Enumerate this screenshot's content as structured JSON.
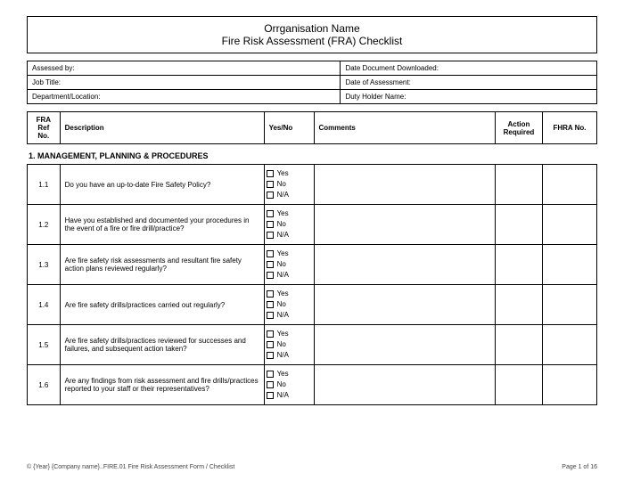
{
  "title": {
    "line1": "Orrganisation Name",
    "line2": "Fire Risk Assessment (FRA) Checklist"
  },
  "meta": {
    "assessed_by": "Assessed by:",
    "date_downloaded": "Date Document Downloaded:",
    "job_title": "Job Title:",
    "date_assessment": "Date of Assessment:",
    "dept_loc": "Department/Location:",
    "duty_holder": "Duty Holder Name:"
  },
  "headers": {
    "ref": "FRA Ref No.",
    "desc": "Description",
    "yn": "Yes/No",
    "comments": "Comments",
    "action": "Action Required",
    "fhra": "FHRA No."
  },
  "yn_options": {
    "yes": "Yes",
    "no": "No",
    "na": "N/A"
  },
  "section": "1. MANAGEMENT, PLANNING & PROCEDURES",
  "items": [
    {
      "ref": "1.1",
      "desc": "Do you have an up-to-date Fire Safety Policy?"
    },
    {
      "ref": "1.2",
      "desc": "Have you established and documented your procedures in the event of a fire or fire drill/practice?"
    },
    {
      "ref": "1.3",
      "desc": "Are fire safety risk assessments and resultant fire safety action plans reviewed regularly?"
    },
    {
      "ref": "1.4",
      "desc": "Are fire safety drills/practices carried out regularly?"
    },
    {
      "ref": "1.5",
      "desc": "Are fire safety drills/practices reviewed for successes and failures, and subsequent action taken?"
    },
    {
      "ref": "1.6",
      "desc": "Are any findings from risk assessment and fire drills/practices reported to your staff or their representatives?"
    }
  ],
  "footer": {
    "left": "© {Year} {Company name}..FIRE.01 Fire Risk Assessment Form / Checklist",
    "right": "Page 1 of 16"
  }
}
